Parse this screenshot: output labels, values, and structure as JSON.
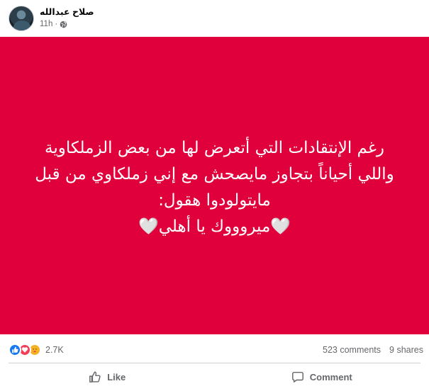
{
  "post": {
    "author_name": "صلاح عبدالله",
    "timestamp": "11h",
    "audience_icon": "globe-icon",
    "options_icon": "more-options-icon"
  },
  "media": {
    "background_color": "#e0003b",
    "text_color": "#ffffff",
    "lines": [
      "رغم الإنتقادات التي أتعرض لها من بعض الزملكاوية",
      "واللي أحياناً بتجاوز مايصحش مع إني زملكاوي من قبل",
      "مايتولودوا هقول:",
      "🤍ميروووك يا أهلي🤍"
    ]
  },
  "stats": {
    "reaction_icons": [
      "like-icon",
      "love-icon",
      "care-icon"
    ],
    "reactions_count": "2.7K",
    "comments": "523 comments",
    "shares": "9 shares"
  },
  "actions": {
    "like_label": "Like",
    "comment_label": "Comment"
  }
}
